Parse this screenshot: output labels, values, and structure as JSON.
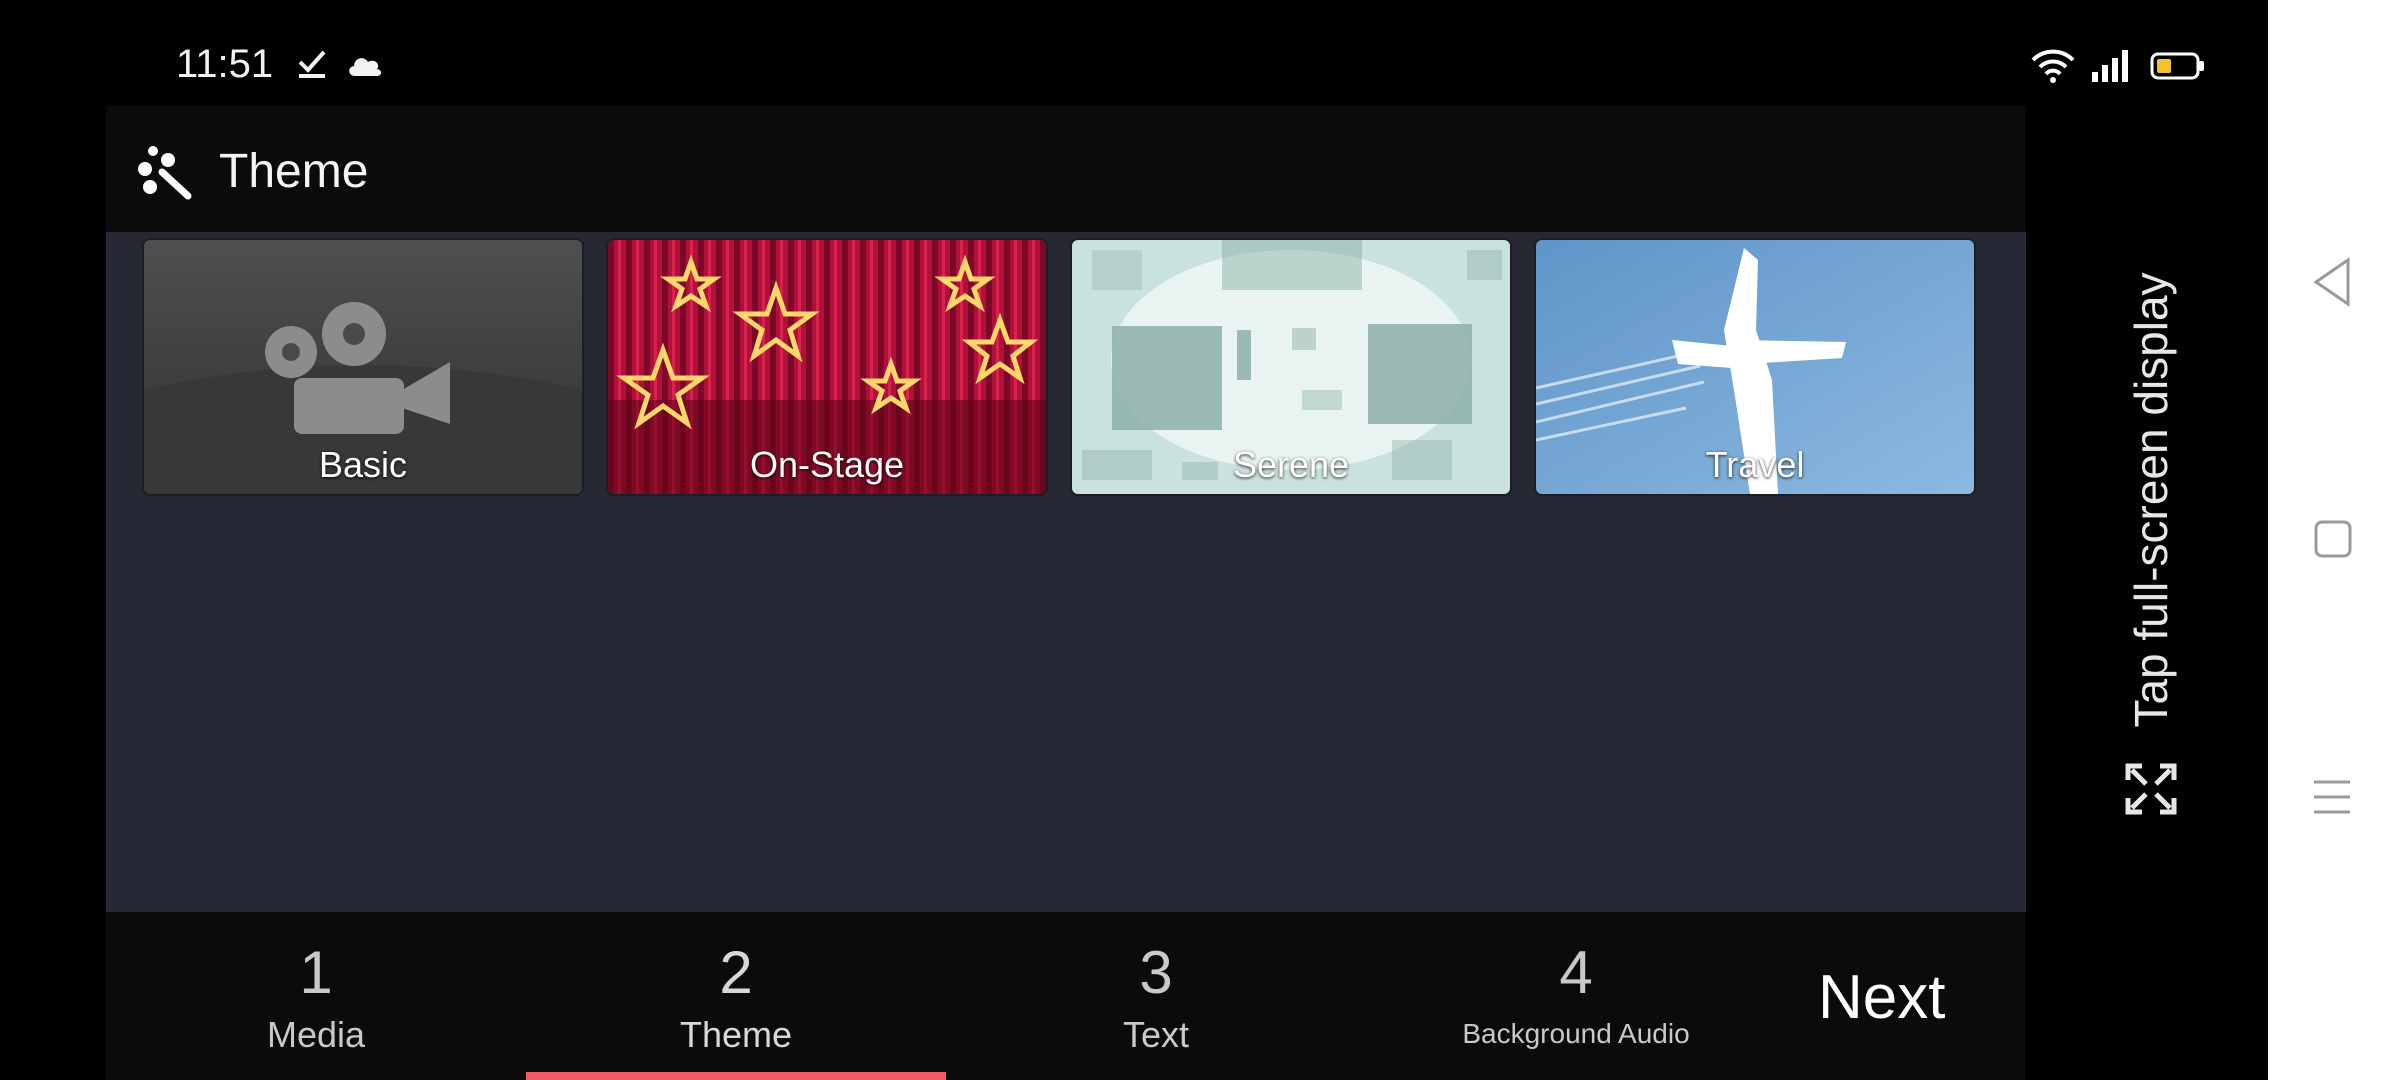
{
  "status_bar": {
    "time": "11:51",
    "icons": [
      "check-icon",
      "cloud-icon",
      "wifi-icon",
      "signal-icon",
      "battery-icon"
    ],
    "battery_color": "#f2c230"
  },
  "header": {
    "icon": "magic-wand-icon",
    "title": "Theme"
  },
  "themes": [
    {
      "label": "Basic",
      "image": "movie-camera"
    },
    {
      "label": "On-Stage",
      "image": "stars-curtain"
    },
    {
      "label": "Serene",
      "image": "abstract-squares"
    },
    {
      "label": "Travel",
      "image": "airplane-sky"
    }
  ],
  "steps": [
    {
      "number": "1",
      "label": "Media"
    },
    {
      "number": "2",
      "label": "Theme",
      "active": true
    },
    {
      "number": "3",
      "label": "Text"
    },
    {
      "number": "4",
      "label": "Background Audio"
    }
  ],
  "next_label": "Next",
  "fullscreen_hint": "Tap full-screen display",
  "colors": {
    "accent": "#ef5a64",
    "app_background": "#262833",
    "header_background": "#0b0b0d"
  },
  "system_nav": [
    "back-icon",
    "home-icon",
    "menu-icon"
  ]
}
